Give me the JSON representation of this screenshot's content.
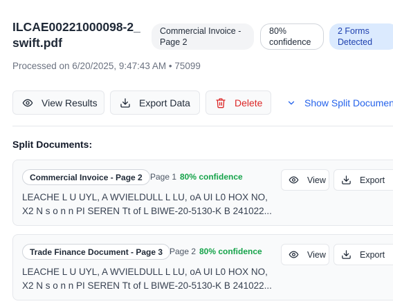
{
  "file": {
    "name": "ILCAE00221000098-2_swift.pdf",
    "processed": "Processed on 6/20/2025, 9:47:43 AM • 75099"
  },
  "badges": {
    "type": "Commercial Invoice - Page 2",
    "confidence": "80% confidence",
    "forms": "2 Forms Detected"
  },
  "toolbar": {
    "view_label": "View Results",
    "export_label": "Export Data",
    "delete_label": "Delete",
    "split_label": "Show Split Documents"
  },
  "split": {
    "title": "Split Documents:",
    "documents": [
      {
        "type": "Commercial Invoice - Page 2",
        "page": "Page 1",
        "confidence": "80% confidence",
        "text": "LEACHE L U UYL, A WVIELDULL L LU, oA UI L0 HOX NO, X2 N s o n n PI SEREN Tt of L BIWE-20-5130-K B 241022...",
        "view_label": "View",
        "export_label": "Export"
      },
      {
        "type": "Trade Finance Document - Page 3",
        "page": "Page 2",
        "confidence": "80% confidence",
        "text": "LEACHE L U UYL, A WVIELDULL L LU, oA UI L0 HOX NO, X2 N s o n n PI SEREN Tt of L BIWE-20-5130-K B 241022...",
        "view_label": "View",
        "export_label": "Export"
      }
    ]
  },
  "colors": {
    "accent": "#2563eb",
    "danger": "#dc2626",
    "success": "#16a34a",
    "badge_blue_bg": "#dbeafe"
  },
  "icons": [
    "eye-icon",
    "download-icon",
    "trash-icon",
    "chevron-down-icon"
  ]
}
